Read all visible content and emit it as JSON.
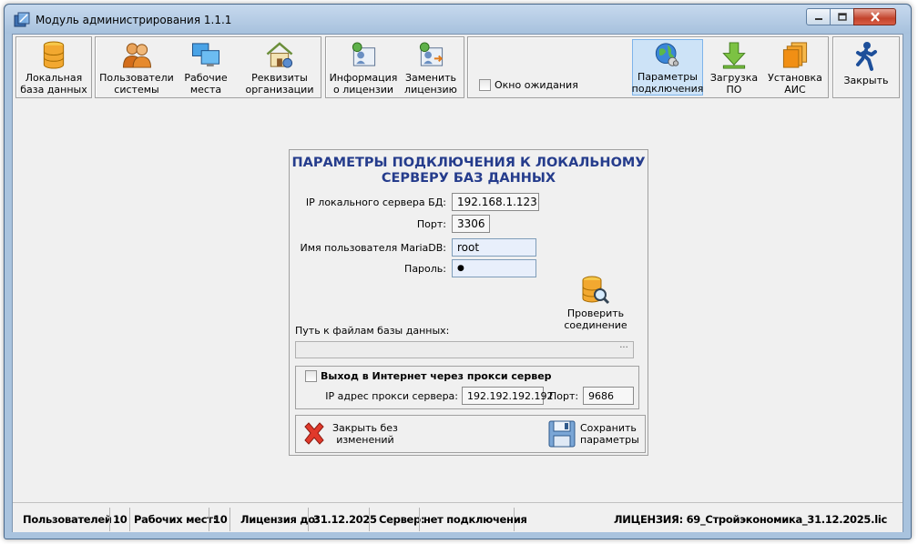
{
  "window": {
    "title": "Модуль администрирования 1.1.1"
  },
  "toolbar": {
    "buttons": [
      {
        "id": "local-db",
        "label": "Локальная\nбаза данных",
        "icon": "database-icon"
      },
      {
        "id": "users",
        "label": "Пользователи\nсистемы",
        "icon": "users-icon"
      },
      {
        "id": "workplaces",
        "label": "Рабочие\nместа",
        "icon": "computers-icon"
      },
      {
        "id": "org-details",
        "label": "Реквизиты\nорганизации",
        "icon": "house-icon"
      },
      {
        "id": "license-info",
        "label": "Информация\nо лицензии",
        "icon": "license-info-icon"
      },
      {
        "id": "replace-license",
        "label": "Заменить\nлицензию",
        "icon": "replace-license-icon"
      },
      {
        "id": "connection-params",
        "label": "Параметры\nподключения",
        "icon": "globe-connection-icon",
        "active": true
      },
      {
        "id": "download",
        "label": "Загрузка\nПО",
        "icon": "download-arrow-icon"
      },
      {
        "id": "install",
        "label": "Установка\nАИС",
        "icon": "install-boxes-icon"
      },
      {
        "id": "close",
        "label": "Закрыть",
        "icon": "walking-man-icon"
      }
    ],
    "wait_window_label": "Окно ожидания",
    "wait_window_checked": false
  },
  "panel": {
    "title_line1": "ПАРАМЕТРЫ ПОДКЛЮЧЕНИЯ К ЛОКАЛЬНОМУ",
    "title_line2": "СЕРВЕРУ БАЗ ДАННЫХ",
    "ip_label": "IP локального сервера БД:",
    "ip_value": "192.168.1.123",
    "port_label": "Порт:",
    "port_value": "3306",
    "user_label": "Имя пользователя MariaDB:",
    "user_value": "root",
    "password_label": "Пароль:",
    "password_value": "●",
    "check_connection_label": "Проверить\nсоединение",
    "db_path_label": "Путь к файлам базы данных:",
    "db_path_value": "",
    "browse_label": "···",
    "proxy": {
      "enabled_label": "Выход в Интернет через прокси сервер",
      "enabled": false,
      "ip_label": "IP адрес прокси сервера:",
      "ip_value": "192.192.192.192",
      "port_label": "Порт:",
      "port_value": "9686"
    },
    "close_without_changes_label": "Закрыть без\nизменений",
    "save_label": "Сохранить\nпараметры"
  },
  "statusbar": {
    "users_label": "Пользователей :",
    "users_value": "10",
    "workplaces_label": "Рабочих мест:",
    "workplaces_value": "10",
    "license_until_label": "Лицензия до:",
    "license_until_value": "31.12.2025",
    "server_label": "Сервер:",
    "server_value": "нет подключения",
    "license_text": "ЛИЦЕНЗИЯ: 69_Стройэкономика_31.12.2025.lic"
  }
}
